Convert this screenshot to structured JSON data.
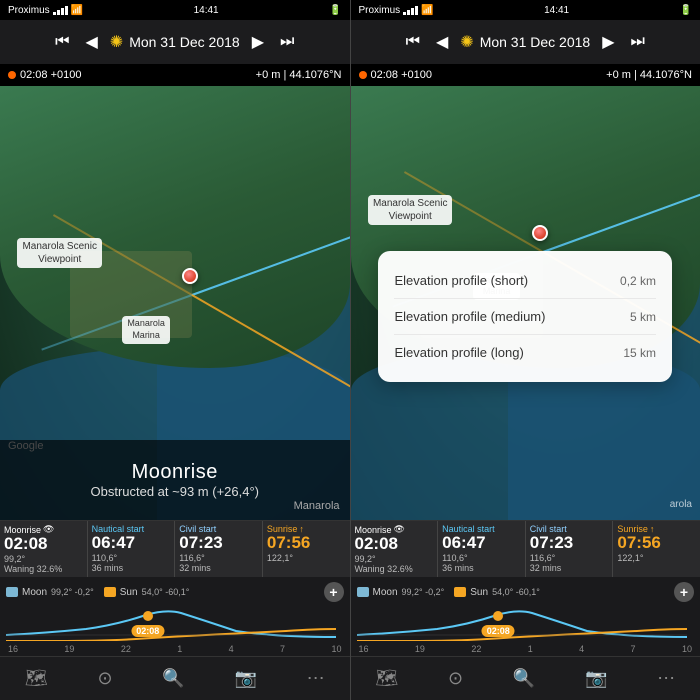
{
  "status": {
    "carrier_left": "Proximus",
    "carrier_right": "Proximus",
    "time_left": "14:41",
    "time_right": "14:41",
    "wifi": "wifi"
  },
  "toolbar": {
    "skip_back_icon": "⏮",
    "prev_icon": "◀",
    "sun_icon": "✺",
    "date": "Mon 31 Dec 2018",
    "next_icon": "▶",
    "skip_fwd_icon": "⏭"
  },
  "info_bar": {
    "time_offset": "02:08 +0100",
    "elevation": "+0 m",
    "coordinates": "44.1076°N"
  },
  "map": {
    "location_name": "Manarola Scenic\nViewpoint",
    "sub_location": "Manarola\nMarina",
    "google_label": "Google",
    "event_label": "Manarola"
  },
  "overlay": {
    "title": "Moonrise",
    "subtitle": "Obstructed at ~93 m (+26,4°)"
  },
  "table": {
    "col1_label": "Moonrise",
    "col1_time": "02:08",
    "col1_sub1": "99,2°",
    "col1_sub2": "Waning 32.6%",
    "col2_label": "Nautical start",
    "col2_time": "06:47",
    "col2_sub1": "110,6°",
    "col2_sub2": "36 mins",
    "col3_label": "Civil start",
    "col3_time": "07:23",
    "col3_sub1": "116,6°",
    "col3_sub2": "32 mins",
    "col4_label": "Sunrise",
    "col4_time": "07:56",
    "col4_sub1": "122,1°"
  },
  "chart": {
    "moon_label": "Moon",
    "moon_az": "99,2°",
    "moon_el": "-0,2°",
    "sun_label": "Sun",
    "sun_az": "54,0°",
    "sun_el": "-60,1°",
    "time_labels": [
      "16",
      "19",
      "22",
      "1",
      "4",
      "7",
      "10"
    ],
    "current_time": "02:08"
  },
  "elevation_popup": {
    "row1_label": "Elevation profile (short)",
    "row1_value": "0,2 km",
    "row2_label": "Elevation profile (medium)",
    "row2_value": "5 km",
    "row3_label": "Elevation profile (long)",
    "row3_value": "15 km"
  },
  "nav": {
    "map_icon": "🗺",
    "compass_icon": "⊙",
    "search_icon": "🔍",
    "camera_icon": "📷",
    "more_icon": "⋯"
  }
}
